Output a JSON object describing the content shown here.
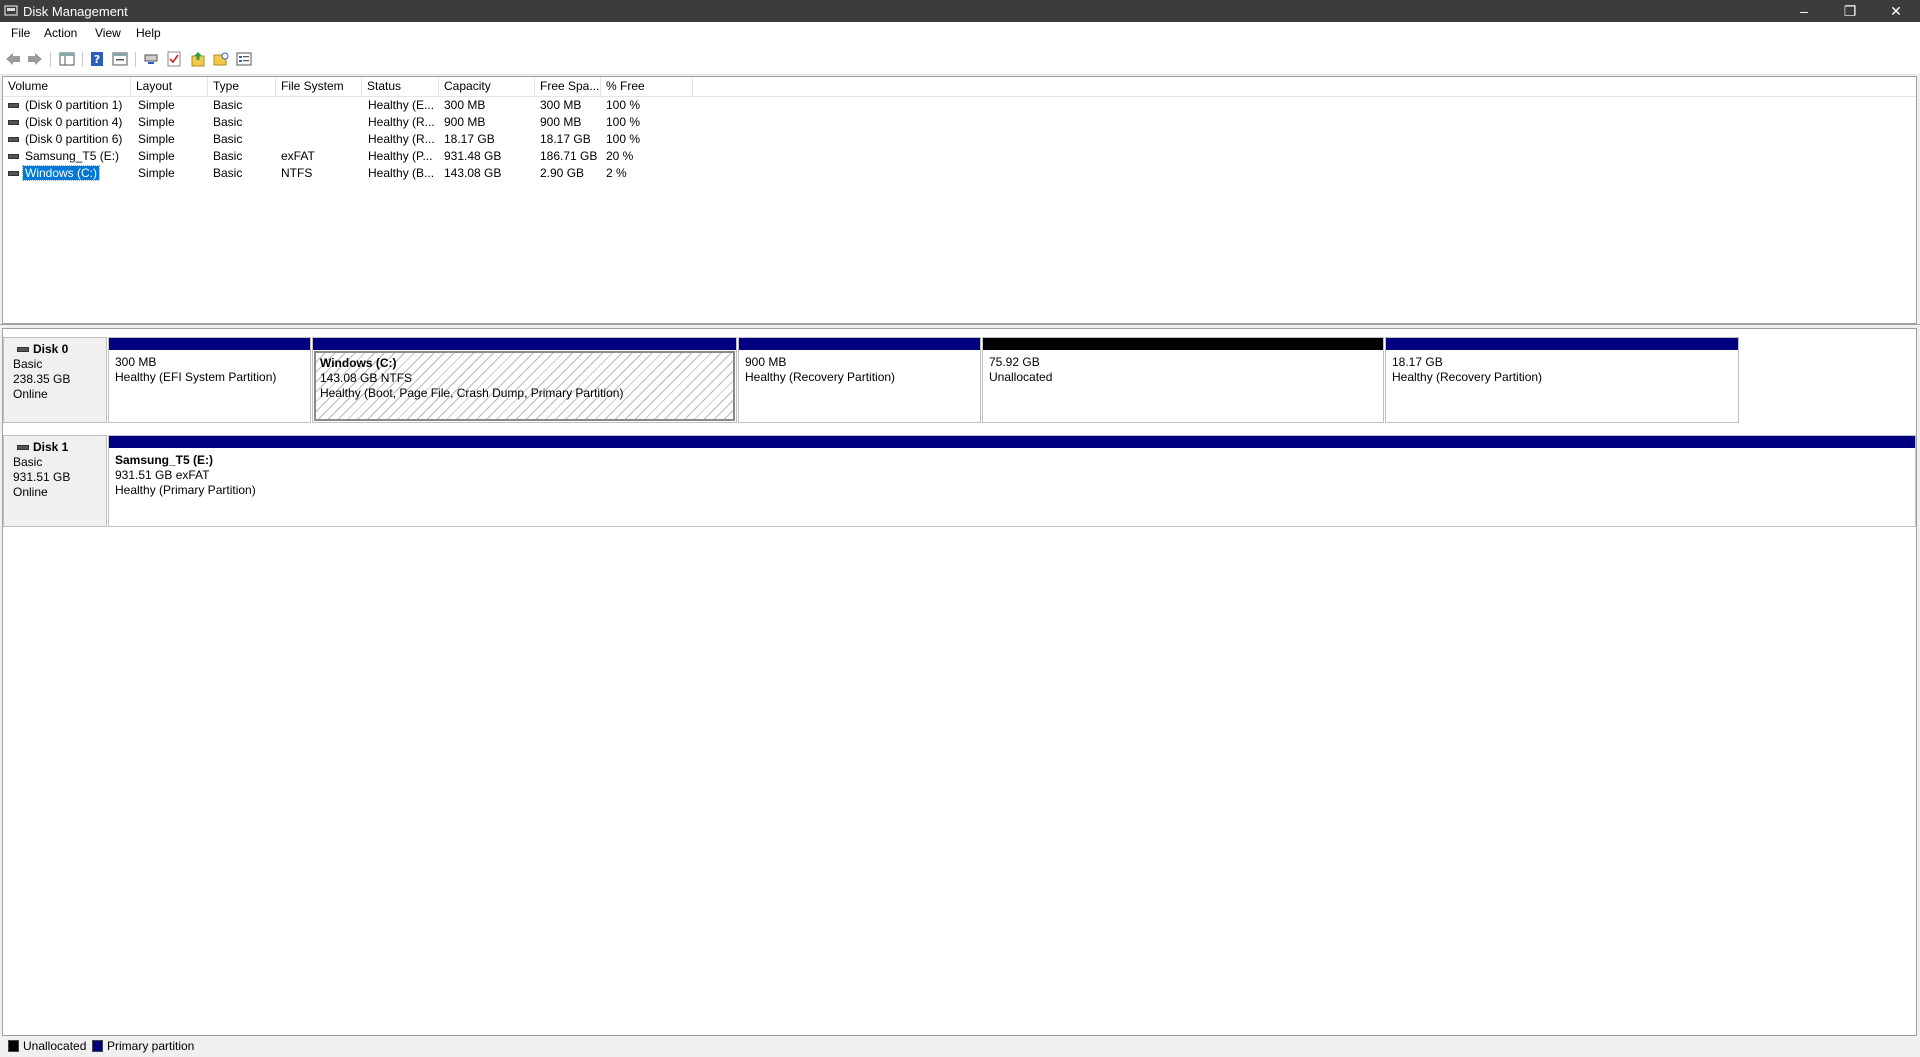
{
  "window": {
    "title": "Disk Management",
    "controls": {
      "minimize": "–",
      "restore": "❐",
      "close": "✕"
    }
  },
  "menu": [
    "File",
    "Action",
    "View",
    "Help"
  ],
  "toolbar": {
    "icons": [
      "back-icon",
      "forward-icon",
      "console-tree-icon",
      "help-icon",
      "properties-icon",
      "rescan-icon",
      "check-icon",
      "export-icon",
      "open-folder-icon",
      "settings-icon"
    ]
  },
  "volume_list": {
    "columns": [
      "Volume",
      "Layout",
      "Type",
      "File System",
      "Status",
      "Capacity",
      "Free Spa...",
      "% Free"
    ],
    "rows": [
      {
        "volume": "(Disk 0 partition 1)",
        "layout": "Simple",
        "type": "Basic",
        "fs": "",
        "status": "Healthy (E...",
        "capacity": "300 MB",
        "free": "300 MB",
        "pct": "100 %"
      },
      {
        "volume": "(Disk 0 partition 4)",
        "layout": "Simple",
        "type": "Basic",
        "fs": "",
        "status": "Healthy (R...",
        "capacity": "900 MB",
        "free": "900 MB",
        "pct": "100 %"
      },
      {
        "volume": "(Disk 0 partition 6)",
        "layout": "Simple",
        "type": "Basic",
        "fs": "",
        "status": "Healthy (R...",
        "capacity": "18.17 GB",
        "free": "18.17 GB",
        "pct": "100 %"
      },
      {
        "volume": "Samsung_T5 (E:)",
        "layout": "Simple",
        "type": "Basic",
        "fs": "exFAT",
        "status": "Healthy (P...",
        "capacity": "931.48 GB",
        "free": "186.71 GB",
        "pct": "20 %"
      },
      {
        "volume": "Windows (C:)",
        "layout": "Simple",
        "type": "Basic",
        "fs": "NTFS",
        "status": "Healthy (B...",
        "capacity": "143.08 GB",
        "free": "2.90 GB",
        "pct": "2 %"
      }
    ]
  },
  "disks": [
    {
      "name": "Disk 0",
      "kind": "Basic",
      "size": "238.35 GB",
      "state": "Online",
      "partitions": [
        {
          "title": "",
          "size": "300 MB",
          "status": "Healthy (EFI System Partition)",
          "bar_color": "#000080"
        },
        {
          "title": "Windows  (C:)",
          "size": "143.08 GB NTFS",
          "status": "Healthy (Boot, Page File, Crash Dump, Primary Partition)",
          "bar_color": "#000080"
        },
        {
          "title": "",
          "size": "900 MB",
          "status": "Healthy (Recovery Partition)",
          "bar_color": "#000080"
        },
        {
          "title": "",
          "size": "75.92 GB",
          "status": "Unallocated",
          "bar_color": "#000000"
        },
        {
          "title": "",
          "size": "18.17 GB",
          "status": "Healthy (Recovery Partition)",
          "bar_color": "#000080"
        }
      ]
    },
    {
      "name": "Disk 1",
      "kind": "Basic",
      "size": "931.51 GB",
      "state": "Online",
      "partitions": [
        {
          "title": "Samsung_T5  (E:)",
          "size": "931.51 GB exFAT",
          "status": "Healthy (Primary Partition)",
          "bar_color": "#000080"
        }
      ]
    }
  ],
  "legend": [
    {
      "label": "Unallocated",
      "color": "#000000"
    },
    {
      "label": "Primary partition",
      "color": "#000080"
    }
  ]
}
